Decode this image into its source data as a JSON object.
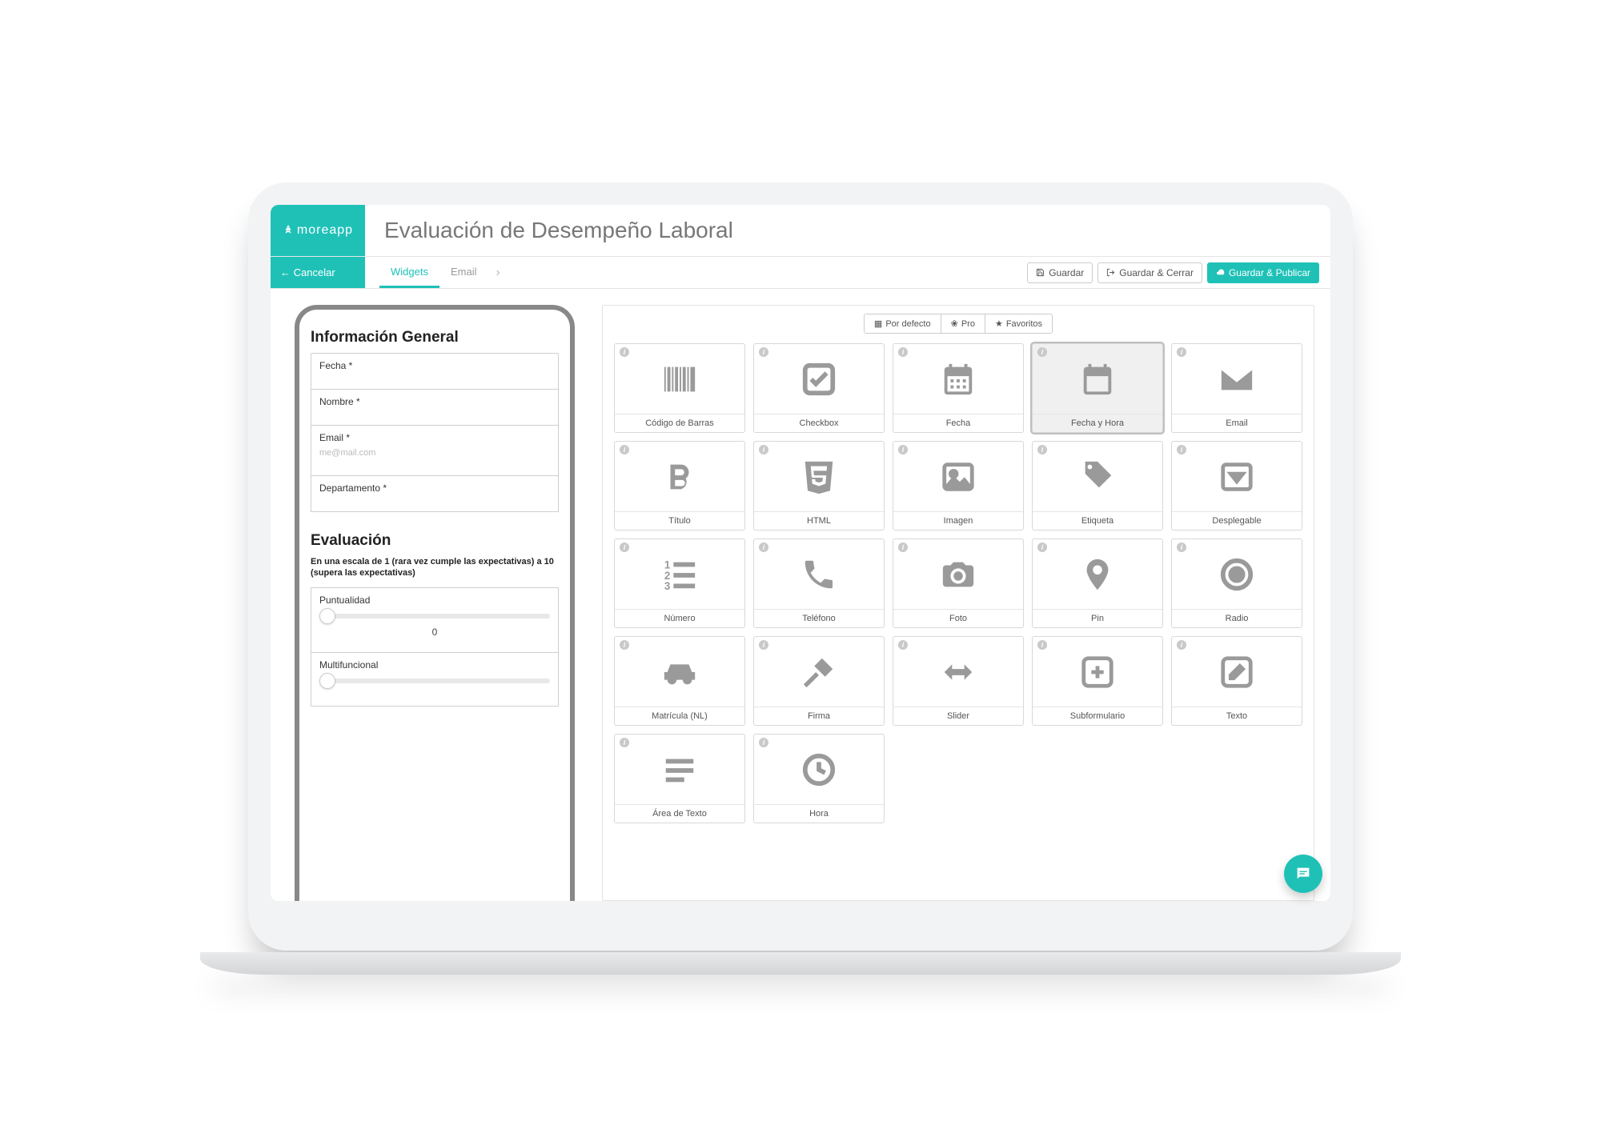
{
  "brand": "moreapp",
  "page_title": "Evaluación de Desempeño Laboral",
  "toolbar": {
    "cancel": "Cancelar",
    "tabs": {
      "widgets": "Widgets",
      "email": "Email"
    },
    "save": "Guardar",
    "save_close": "Guardar & Cerrar",
    "save_publish": "Guardar & Publicar"
  },
  "filters": {
    "default": "Por defecto",
    "pro": "Pro",
    "favorites": "Favoritos"
  },
  "preview": {
    "section1_title": "Información General",
    "fields": {
      "fecha": "Fecha *",
      "nombre": "Nombre *",
      "email": "Email *",
      "email_placeholder": "me@mail.com",
      "departamento": "Departamento *"
    },
    "section2_title": "Evaluación",
    "scale_note": "En una escala de 1 (rara vez cumple las expectativas) a 10 (supera las expectativas)",
    "sliders": {
      "puntualidad": {
        "label": "Puntualidad",
        "value": "0"
      },
      "multifuncional": {
        "label": "Multifuncional",
        "value": "0"
      }
    }
  },
  "widgets": {
    "barcode": "Código de Barras",
    "checkbox": "Checkbox",
    "date": "Fecha",
    "datetime": "Fecha y Hora",
    "email": "Email",
    "title": "Título",
    "html": "HTML",
    "image": "Imagen",
    "label": "Etiqueta",
    "dropdown": "Desplegable",
    "number": "Número",
    "phone": "Teléfono",
    "photo": "Foto",
    "pin": "Pin",
    "radio": "Radio",
    "licenseplate": "Matrícula (NL)",
    "signature": "Firma",
    "slider": "Slider",
    "subform": "Subformulario",
    "text": "Texto",
    "textarea": "Área de Texto",
    "time": "Hora"
  }
}
